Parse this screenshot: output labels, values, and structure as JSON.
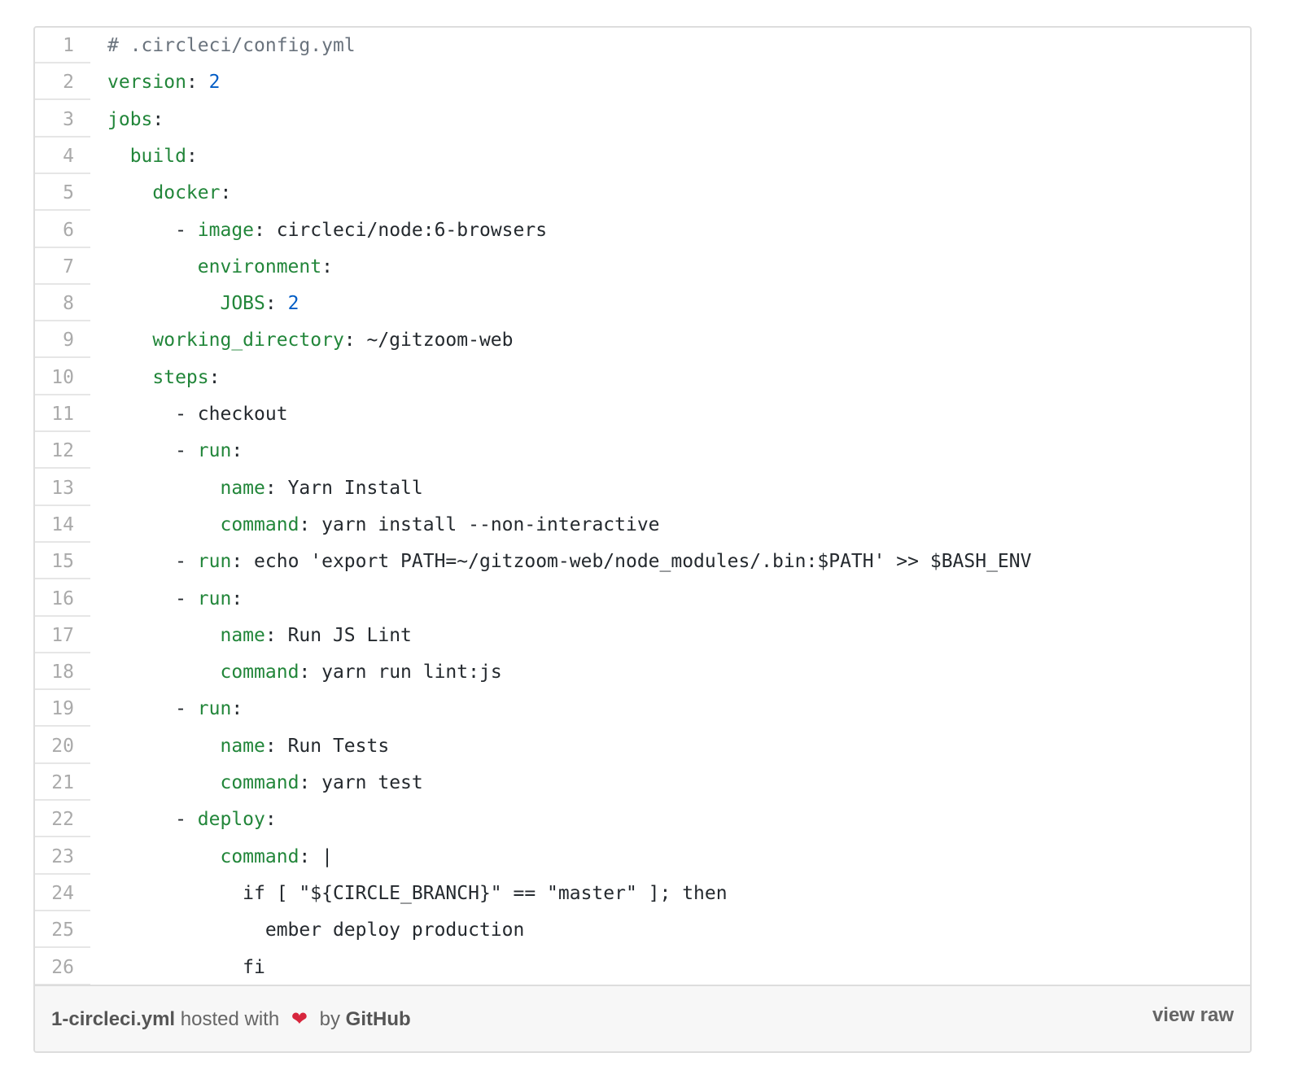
{
  "gist": {
    "lines": [
      {
        "num": "1",
        "tokens": [
          {
            "t": "# .circleci/config.yml",
            "s": "c"
          }
        ]
      },
      {
        "num": "2",
        "tokens": [
          {
            "t": "version",
            "s": "k"
          },
          {
            "t": ": "
          },
          {
            "t": "2",
            "s": "n"
          }
        ]
      },
      {
        "num": "3",
        "tokens": [
          {
            "t": "jobs",
            "s": "k"
          },
          {
            "t": ":"
          }
        ]
      },
      {
        "num": "4",
        "tokens": [
          {
            "t": "  "
          },
          {
            "t": "build",
            "s": "k"
          },
          {
            "t": ":"
          }
        ]
      },
      {
        "num": "5",
        "tokens": [
          {
            "t": "    "
          },
          {
            "t": "docker",
            "s": "k"
          },
          {
            "t": ":"
          }
        ]
      },
      {
        "num": "6",
        "tokens": [
          {
            "t": "      - "
          },
          {
            "t": "image",
            "s": "k"
          },
          {
            "t": ": circleci/node:6-browsers"
          }
        ]
      },
      {
        "num": "7",
        "tokens": [
          {
            "t": "        "
          },
          {
            "t": "environment",
            "s": "k"
          },
          {
            "t": ":"
          }
        ]
      },
      {
        "num": "8",
        "tokens": [
          {
            "t": "          "
          },
          {
            "t": "JOBS",
            "s": "k"
          },
          {
            "t": ": "
          },
          {
            "t": "2",
            "s": "n"
          }
        ]
      },
      {
        "num": "9",
        "tokens": [
          {
            "t": "    "
          },
          {
            "t": "working_directory",
            "s": "k"
          },
          {
            "t": ": ~/gitzoom-web"
          }
        ]
      },
      {
        "num": "10",
        "tokens": [
          {
            "t": "    "
          },
          {
            "t": "steps",
            "s": "k"
          },
          {
            "t": ":"
          }
        ]
      },
      {
        "num": "11",
        "tokens": [
          {
            "t": "      - checkout"
          }
        ]
      },
      {
        "num": "12",
        "tokens": [
          {
            "t": "      - "
          },
          {
            "t": "run",
            "s": "k"
          },
          {
            "t": ":"
          }
        ]
      },
      {
        "num": "13",
        "tokens": [
          {
            "t": "          "
          },
          {
            "t": "name",
            "s": "k"
          },
          {
            "t": ": Yarn Install"
          }
        ]
      },
      {
        "num": "14",
        "tokens": [
          {
            "t": "          "
          },
          {
            "t": "command",
            "s": "k"
          },
          {
            "t": ": yarn install --non-interactive"
          }
        ]
      },
      {
        "num": "15",
        "tokens": [
          {
            "t": "      - "
          },
          {
            "t": "run",
            "s": "k"
          },
          {
            "t": ": echo 'export PATH=~/gitzoom-web/node_modules/.bin:$PATH' >> $BASH_ENV"
          }
        ]
      },
      {
        "num": "16",
        "tokens": [
          {
            "t": "      - "
          },
          {
            "t": "run",
            "s": "k"
          },
          {
            "t": ":"
          }
        ]
      },
      {
        "num": "17",
        "tokens": [
          {
            "t": "          "
          },
          {
            "t": "name",
            "s": "k"
          },
          {
            "t": ": Run JS Lint"
          }
        ]
      },
      {
        "num": "18",
        "tokens": [
          {
            "t": "          "
          },
          {
            "t": "command",
            "s": "k"
          },
          {
            "t": ": yarn run lint:js"
          }
        ]
      },
      {
        "num": "19",
        "tokens": [
          {
            "t": "      - "
          },
          {
            "t": "run",
            "s": "k"
          },
          {
            "t": ":"
          }
        ]
      },
      {
        "num": "20",
        "tokens": [
          {
            "t": "          "
          },
          {
            "t": "name",
            "s": "k"
          },
          {
            "t": ": Run Tests"
          }
        ]
      },
      {
        "num": "21",
        "tokens": [
          {
            "t": "          "
          },
          {
            "t": "command",
            "s": "k"
          },
          {
            "t": ": yarn test"
          }
        ]
      },
      {
        "num": "22",
        "tokens": [
          {
            "t": "      - "
          },
          {
            "t": "deploy",
            "s": "k"
          },
          {
            "t": ":"
          }
        ]
      },
      {
        "num": "23",
        "tokens": [
          {
            "t": "          "
          },
          {
            "t": "command",
            "s": "k"
          },
          {
            "t": ": |"
          }
        ]
      },
      {
        "num": "24",
        "tokens": [
          {
            "t": "            if [ \"${CIRCLE_BRANCH}\" == \"master\" ]; then"
          }
        ]
      },
      {
        "num": "25",
        "tokens": [
          {
            "t": "              ember deploy production"
          }
        ]
      },
      {
        "num": "26",
        "tokens": [
          {
            "t": "            fi"
          }
        ]
      }
    ]
  },
  "footer": {
    "filename": "1-circleci.yml",
    "hosted_with": "hosted with",
    "heart": "❤",
    "by": "by",
    "host": "GitHub",
    "view_raw": "view raw"
  },
  "colors": {
    "key": "#22863a",
    "number": "#005cc5",
    "comment": "#6a737d",
    "text": "#24292e",
    "heart": "#d7263d"
  }
}
